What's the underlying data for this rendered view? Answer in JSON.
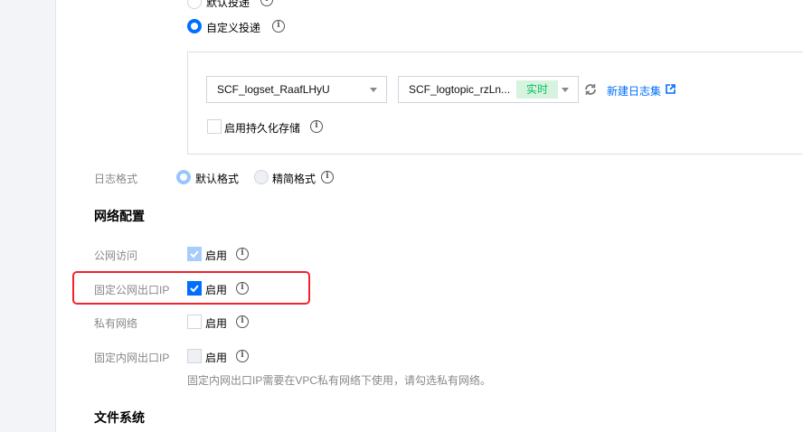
{
  "delivery": {
    "default_label": "默认投递",
    "custom_label": "自定义投递",
    "selected": "custom"
  },
  "logset": {
    "value": "SCF_logset_RaafLHyU"
  },
  "logtopic": {
    "value": "SCF_logtopic_rzLn...",
    "tag": "实时"
  },
  "new_logset_link": "新建日志集",
  "persist": {
    "label": "启用持久化存储",
    "checked": false
  },
  "log_format": {
    "label": "日志格式",
    "options": [
      "默认格式",
      "精简格式"
    ],
    "selected": "默认格式"
  },
  "network": {
    "title": "网络配置",
    "rows": [
      {
        "label": "公网访问",
        "option": "启用",
        "state": "checked-disabled"
      },
      {
        "label": "固定公网出口IP",
        "option": "启用",
        "state": "checked"
      },
      {
        "label": "私有网络",
        "option": "启用",
        "state": "unchecked"
      },
      {
        "label": "固定内网出口IP",
        "option": "启用",
        "state": "disabled"
      }
    ],
    "hint": "固定内网出口IP需要在VPC私有网络下使用，请勾选私有网络。"
  },
  "file_system": {
    "title": "文件系统"
  },
  "colors": {
    "primary": "#006eff",
    "highlight": "#f5222d",
    "tag_bg": "#d6f3e0",
    "tag_text": "#0abf5b"
  }
}
